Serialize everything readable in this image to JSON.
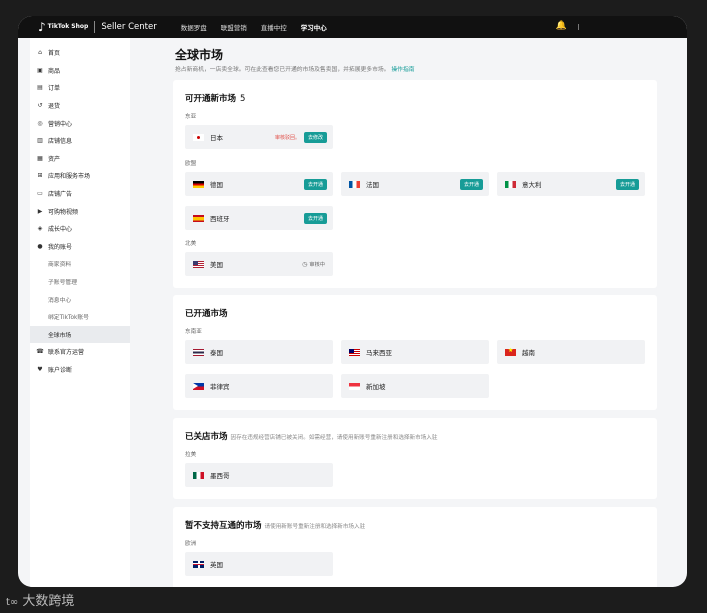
{
  "topbar": {
    "logo_brand": "TikTok Shop",
    "app_name": "Seller Center",
    "nav": [
      "数据罗盘",
      "联盟营销",
      "直播中控",
      "学习中心"
    ],
    "active_nav_index": 3
  },
  "sidebar": {
    "items": [
      {
        "label": "首页",
        "icon": "home-icon"
      },
      {
        "label": "商品",
        "icon": "product-icon"
      },
      {
        "label": "订单",
        "icon": "order-icon"
      },
      {
        "label": "退货",
        "icon": "return-icon"
      },
      {
        "label": "营销中心",
        "icon": "marketing-icon"
      },
      {
        "label": "店铺信息",
        "icon": "store-icon"
      },
      {
        "label": "资产",
        "icon": "asset-icon"
      },
      {
        "label": "应用和服务市场",
        "icon": "apps-icon"
      },
      {
        "label": "店铺广告",
        "icon": "ads-icon"
      },
      {
        "label": "可购物视频",
        "icon": "video-icon"
      },
      {
        "label": "成长中心",
        "icon": "growth-icon"
      },
      {
        "label": "我的账号",
        "icon": "account-icon"
      }
    ],
    "account_subitems": [
      "商家资料",
      "子账号管理",
      "消息中心",
      "绑定TikTok账号",
      "全球市场"
    ],
    "active_subitem": "全球市场",
    "tail_items": [
      {
        "label": "联系官方运营",
        "icon": "contact-icon"
      },
      {
        "label": "账户诊断",
        "icon": "diagnosis-icon"
      }
    ]
  },
  "page": {
    "title": "全球市场",
    "desc": "抢占新商机，一店卖全球。可在此查看您已开通的市场及售卖国，并拓展更多市场。",
    "desc_link": "操作指南"
  },
  "available": {
    "title": "可开通新市场",
    "count": "5",
    "regions": [
      {
        "name": "东亚",
        "markets": [
          {
            "name": "日本",
            "flag": "jp",
            "warn": "审核驳回。",
            "action": "去修改"
          }
        ]
      },
      {
        "name": "欧盟",
        "markets": [
          {
            "name": "德国",
            "flag": "de",
            "action": "去开通"
          },
          {
            "name": "法国",
            "flag": "fr",
            "action": "去开通"
          },
          {
            "name": "意大利",
            "flag": "it",
            "action": "去开通"
          },
          {
            "name": "西班牙",
            "flag": "es",
            "action": "去开通"
          }
        ]
      },
      {
        "name": "北美",
        "markets": [
          {
            "name": "美国",
            "flag": "us",
            "status": "审核中"
          }
        ]
      }
    ]
  },
  "opened": {
    "title": "已开通市场",
    "region": "东南亚",
    "markets": [
      {
        "name": "泰国",
        "flag": "th"
      },
      {
        "name": "马来西亚",
        "flag": "my"
      },
      {
        "name": "越南",
        "flag": "vn"
      },
      {
        "name": "菲律宾",
        "flag": "ph"
      },
      {
        "name": "新加坡",
        "flag": "sg"
      }
    ]
  },
  "closed": {
    "title": "已关店市场",
    "note": "因存在违规经营店铺已被关闭。如需经营，请使用新账号重新注册和选择新市场入驻",
    "region": "拉美",
    "markets": [
      {
        "name": "墨西哥",
        "flag": "mx"
      }
    ]
  },
  "unsupported": {
    "title": "暂不支持互通的市场",
    "note": "请使用新账号重新注册和选择新市场入驻",
    "region": "欧洲",
    "markets": [
      {
        "name": "英国",
        "flag": "gb"
      }
    ]
  },
  "watermark": "大数跨境"
}
